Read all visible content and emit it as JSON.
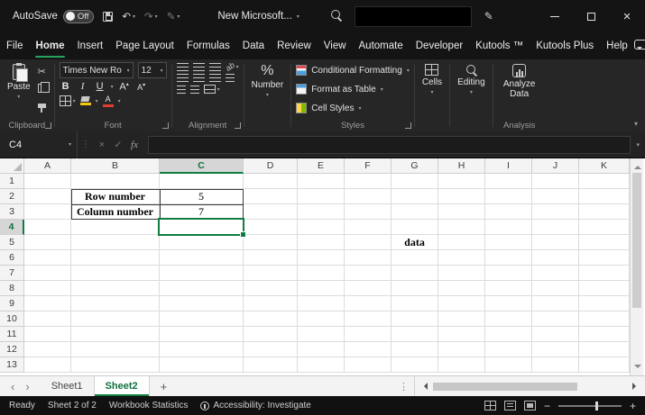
{
  "titlebar": {
    "autosave_label": "AutoSave",
    "autosave_state": "Off",
    "title": "New Microsoft..."
  },
  "menu_tabs": [
    {
      "label": "File",
      "active": false
    },
    {
      "label": "Home",
      "active": true
    },
    {
      "label": "Insert",
      "active": false
    },
    {
      "label": "Page Layout",
      "active": false
    },
    {
      "label": "Formulas",
      "active": false
    },
    {
      "label": "Data",
      "active": false
    },
    {
      "label": "Review",
      "active": false
    },
    {
      "label": "View",
      "active": false
    },
    {
      "label": "Automate",
      "active": false
    },
    {
      "label": "Developer",
      "active": false
    },
    {
      "label": "Kutools ™",
      "active": false
    },
    {
      "label": "Kutools Plus",
      "active": false
    },
    {
      "label": "Help",
      "active": false
    }
  ],
  "ribbon": {
    "paste_label": "Paste",
    "clipboard_group_label": "Clipboard",
    "font_name": "Times New Ro",
    "font_size": "12",
    "font_group_label": "Font",
    "alignment_group_label": "Alignment",
    "number_button_label": "Number",
    "styles_buttons": {
      "conditional_formatting": "Conditional Formatting",
      "format_as_table": "Format as Table",
      "cell_styles": "Cell Styles"
    },
    "styles_group_label": "Styles",
    "cells_button_label": "Cells",
    "editing_button_label": "Editing",
    "analyze_data_label": "Analyze Data",
    "analysis_group_label": "Analysis"
  },
  "formula_bar": {
    "name_box_value": "C4",
    "formula_value": ""
  },
  "grid": {
    "column_headers": [
      "A",
      "B",
      "C",
      "D",
      "E",
      "F",
      "G",
      "H",
      "I",
      "J",
      "K"
    ],
    "row_headers": [
      "1",
      "2",
      "3",
      "4",
      "5",
      "6",
      "7",
      "8",
      "9",
      "10",
      "11",
      "12",
      "13"
    ],
    "selected_column": "C",
    "selected_row": "4",
    "selected_cell": "C4",
    "cells": {
      "B2": "Row number",
      "C2": "5",
      "B3": "Column number",
      "C3": "7",
      "G5": "data"
    },
    "bold_cells": [
      "B2",
      "B3",
      "G5"
    ]
  },
  "sheet_bar": {
    "tabs": [
      {
        "label": "Sheet1",
        "active": false
      },
      {
        "label": "Sheet2",
        "active": true
      }
    ],
    "add_sheet_label": "+"
  },
  "status_bar": {
    "mode": "Ready",
    "sheet_info": "Sheet 2 of 2",
    "workbook_statistics": "Workbook Statistics",
    "accessibility": "Accessibility: Investigate"
  },
  "colors": {
    "excel_selection_green": "#107C41",
    "tab_underline_green": "#27a35f",
    "share_button_green": "#1da758",
    "titlebar_bg": "#141414",
    "ribbon_bg": "#262626"
  }
}
